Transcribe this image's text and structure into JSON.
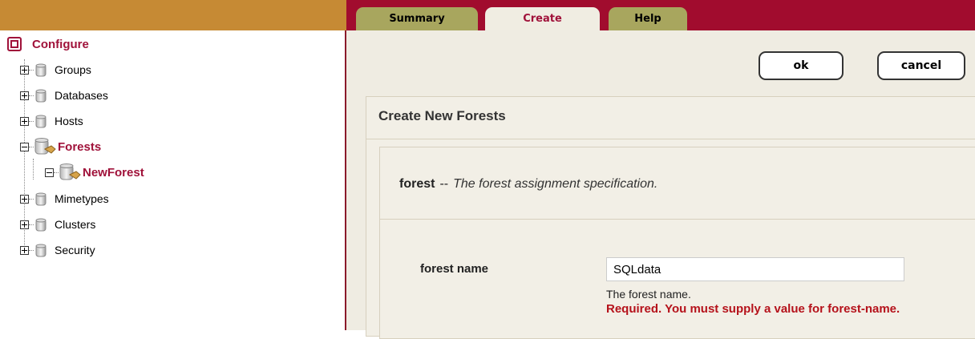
{
  "tabs": [
    {
      "label": "Summary"
    },
    {
      "label": "Create"
    },
    {
      "label": "Help"
    }
  ],
  "sidebar": {
    "root": {
      "label": "Configure",
      "icon": "configure-icon"
    },
    "items": [
      {
        "label": "Groups",
        "icon": "database-icon",
        "expanded": false
      },
      {
        "label": "Databases",
        "icon": "database-icon",
        "expanded": false
      },
      {
        "label": "Hosts",
        "icon": "database-icon",
        "expanded": false
      },
      {
        "label": "Forests",
        "icon": "forest-icon",
        "expanded": true,
        "active": true
      },
      {
        "label": "NewForest",
        "icon": "forest-icon",
        "expanded": true,
        "active": true,
        "child": true
      },
      {
        "label": "Mimetypes",
        "icon": "database-icon",
        "expanded": false
      },
      {
        "label": "Clusters",
        "icon": "database-icon",
        "expanded": false
      },
      {
        "label": "Security",
        "icon": "database-icon",
        "expanded": false
      }
    ]
  },
  "actions": {
    "ok_label": "ok",
    "cancel_label": "cancel"
  },
  "panel": {
    "title": "Create New Forests",
    "section_name": "forest",
    "section_sep": "--",
    "section_desc": "The forest assignment specification.",
    "field_label": "forest name",
    "field_value": "SQLdata",
    "field_help": "The forest name.",
    "field_error": "Required. You must supply a value for forest-name."
  },
  "colors": {
    "accent": "#A0123A",
    "tabbar": "#A10C2E",
    "sidebar_header": "#C68A34",
    "error": "#B5121B"
  }
}
